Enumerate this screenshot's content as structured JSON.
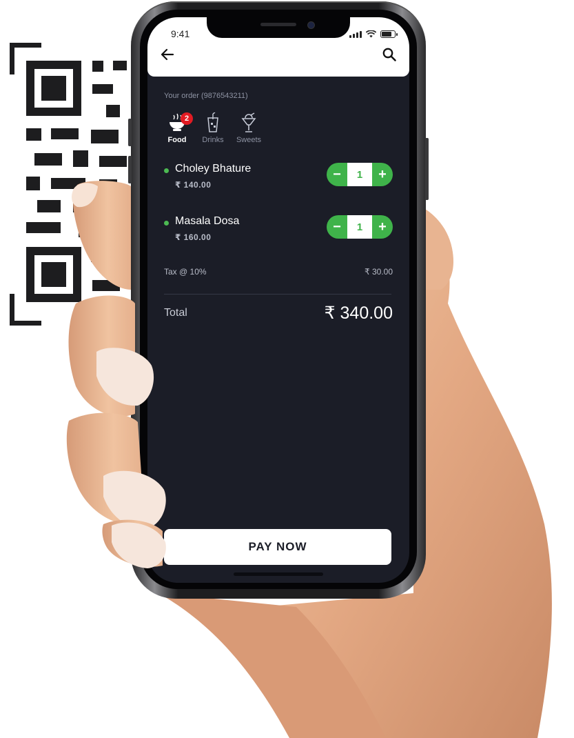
{
  "status_bar": {
    "time": "9:41"
  },
  "header": {
    "back_icon": "arrow-left-icon",
    "search_icon": "search-icon"
  },
  "order": {
    "label": "Your order (9876543211)"
  },
  "categories": [
    {
      "label": "Food",
      "icon": "food-bowl-icon",
      "badge": "2",
      "active": true
    },
    {
      "label": "Drinks",
      "icon": "drink-glass-icon",
      "active": false
    },
    {
      "label": "Sweets",
      "icon": "sundae-icon",
      "active": false
    }
  ],
  "items": [
    {
      "name": "Choley Bhature",
      "price": "₹ 140.00",
      "qty": "1",
      "minus": "−",
      "plus": "+"
    },
    {
      "name": "Masala Dosa",
      "price": "₹ 160.00",
      "qty": "1",
      "minus": "−",
      "plus": "+"
    }
  ],
  "tax": {
    "label": "Tax @ 10%",
    "value": "₹ 30.00"
  },
  "total": {
    "label": "Total",
    "value": "₹ 340.00"
  },
  "pay_button": {
    "label": "PAY NOW"
  },
  "colors": {
    "screen_bg": "#1b1d27",
    "accent_green": "#3fb34a",
    "badge_red": "#e21b23",
    "header_bg": "#ffffff"
  }
}
